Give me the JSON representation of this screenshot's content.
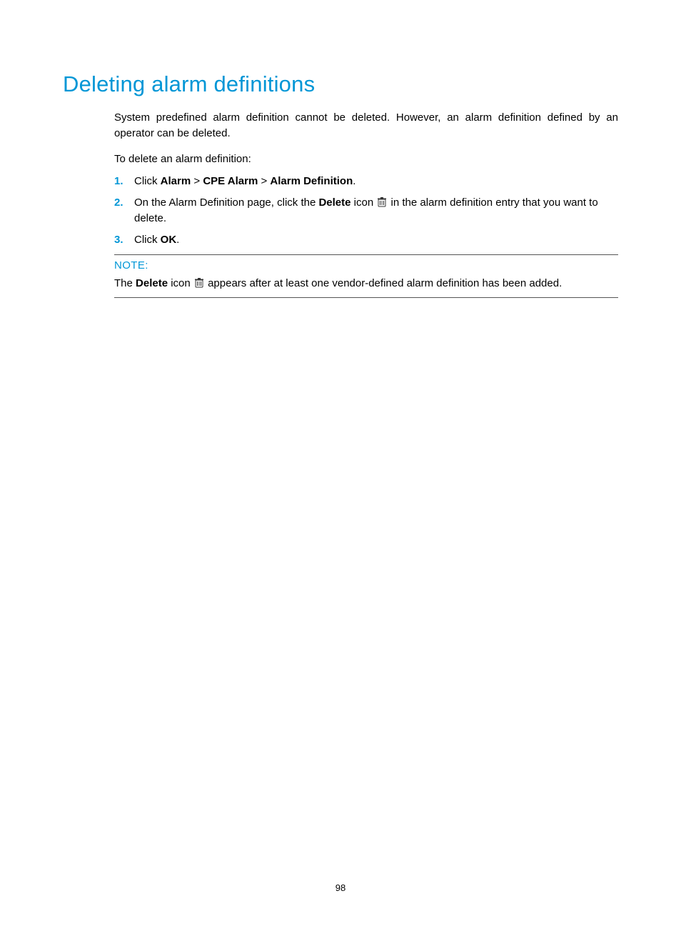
{
  "title": "Deleting alarm definitions",
  "intro": "System predefined alarm definition cannot be deleted. However, an alarm definition defined by an operator can be deleted.",
  "lead": "To delete an alarm definition:",
  "steps": {
    "s1": {
      "num": "1.",
      "pre": "Click ",
      "b1": "Alarm",
      "mid1": " > ",
      "b2": "CPE Alarm",
      "mid2": " > ",
      "b3": "Alarm Definition",
      "post": "."
    },
    "s2": {
      "num": "2.",
      "pre": "On the Alarm Definition page, click the ",
      "b1": "Delete",
      "mid": " icon",
      "post": " in the alarm definition entry that you want to delete."
    },
    "s3": {
      "num": "3.",
      "pre": "Click ",
      "b1": "OK",
      "post": "."
    }
  },
  "note": {
    "label": "NOTE:",
    "pre": "The ",
    "b1": "Delete",
    "mid": " icon",
    "post": " appears after at least one vendor-defined alarm definition has been added."
  },
  "page_number": "98"
}
